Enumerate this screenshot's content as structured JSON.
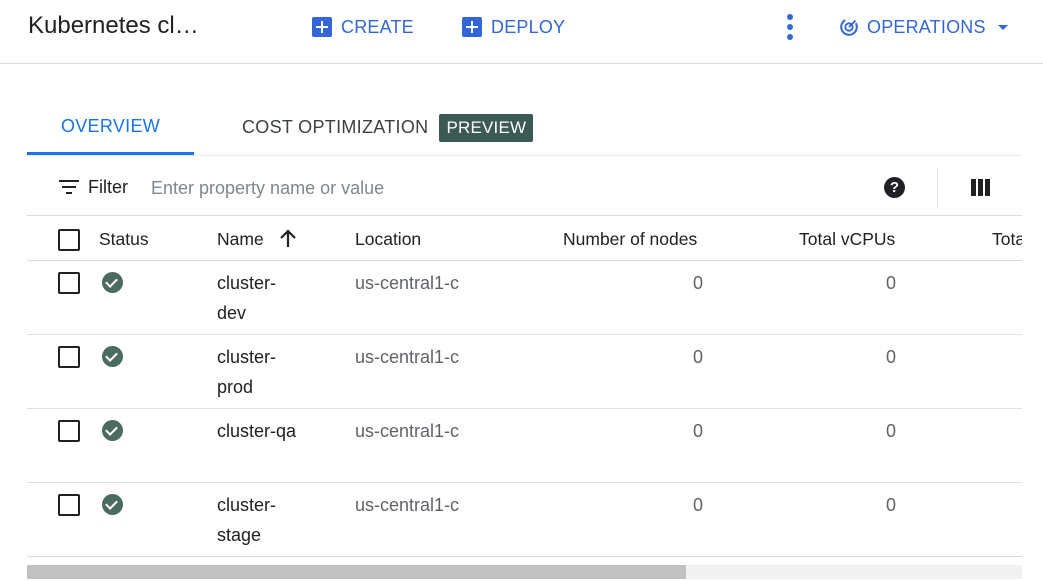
{
  "header": {
    "title": "Kubernetes cl…",
    "create_label": "CREATE",
    "deploy_label": "DEPLOY",
    "operations_label": "OPERATIONS",
    "accent_color": "#3367d6"
  },
  "tabs": [
    {
      "label": "OVERVIEW",
      "active": true
    },
    {
      "label": "COST OPTIMIZATION",
      "badge": "PREVIEW",
      "active": false
    }
  ],
  "filter": {
    "label": "Filter",
    "placeholder": "Enter property name or value",
    "help_icon": "help-circle-icon",
    "columns_icon": "column-display-icon"
  },
  "table": {
    "headers": {
      "status": "Status",
      "name": "Name",
      "location": "Location",
      "nodes": "Number of nodes",
      "vcpus": "Total vCPUs",
      "total_truncated": "Tota"
    },
    "sort": {
      "column": "Name",
      "direction": "ascending"
    },
    "rows": [
      {
        "name_line1": "cluster-",
        "name_line2": "dev",
        "location": "us-central1-c",
        "nodes": "0",
        "vcpus": "0",
        "status": "ok"
      },
      {
        "name_line1": "cluster-",
        "name_line2": "prod",
        "location": "us-central1-c",
        "nodes": "0",
        "vcpus": "0",
        "status": "ok"
      },
      {
        "name_line1": "cluster-qa",
        "name_line2": "",
        "location": "us-central1-c",
        "nodes": "0",
        "vcpus": "0",
        "status": "ok"
      },
      {
        "name_line1": "cluster-",
        "name_line2": "stage",
        "location": "us-central1-c",
        "nodes": "0",
        "vcpus": "0",
        "status": "ok"
      }
    ]
  }
}
